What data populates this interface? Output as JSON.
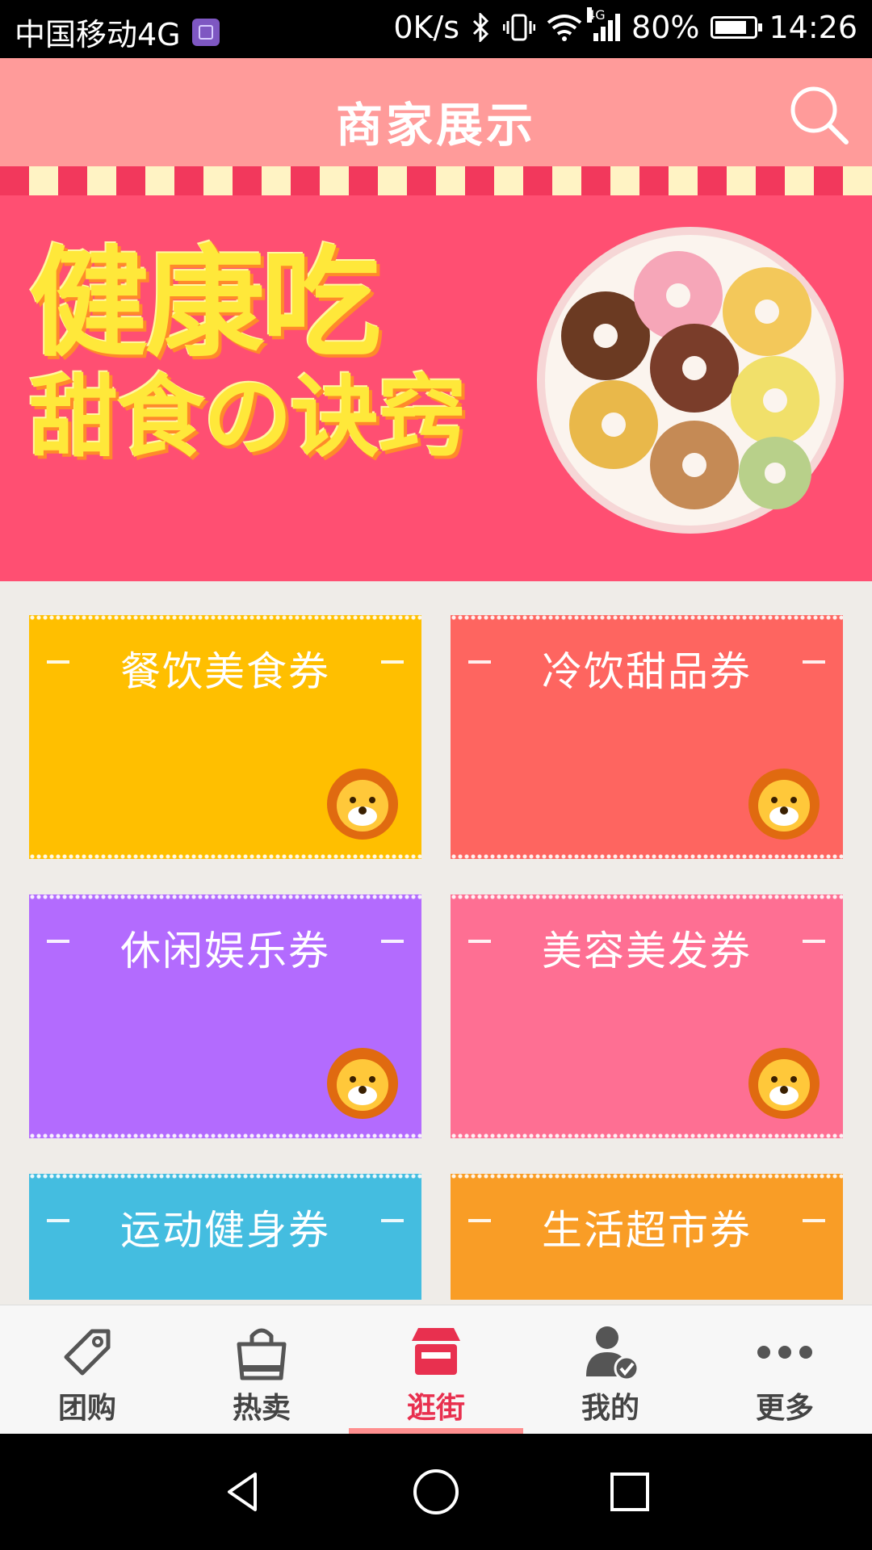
{
  "status_bar": {
    "carrier": "中国移动4G",
    "speed": "0K/s",
    "network_tag": "4G",
    "battery": "80%",
    "time": "14:26"
  },
  "header": {
    "title": "商家展示",
    "search_icon": "search-icon",
    "background_color": "#ff9b9a"
  },
  "banner": {
    "line1": "健康吃",
    "line2": "甜食の诀窍",
    "indicator_count": 1,
    "active_index": 0
  },
  "coupons": [
    {
      "label": "餐饮美食券",
      "color": "#ffbf00"
    },
    {
      "label": "冷饮甜品券",
      "color": "#fe6560"
    },
    {
      "label": "休闲娱乐券",
      "color": "#b36bfe"
    },
    {
      "label": "美容美发券",
      "color": "#fe6f93"
    },
    {
      "label": "运动健身券",
      "color": "#44bde0"
    },
    {
      "label": "生活超市券",
      "color": "#f99d26"
    }
  ],
  "tabs": [
    {
      "label": "团购",
      "icon": "tag-icon"
    },
    {
      "label": "热卖",
      "icon": "shopping-bag-icon"
    },
    {
      "label": "逛街",
      "icon": "storefront-icon",
      "active": true
    },
    {
      "label": "我的",
      "icon": "user-check-icon"
    },
    {
      "label": "更多",
      "icon": "more-dots-icon"
    }
  ],
  "colors": {
    "active_tab": "#e8304f",
    "accent": "#ff8f8f"
  }
}
